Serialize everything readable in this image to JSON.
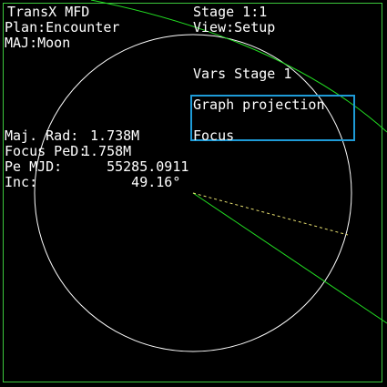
{
  "mfd": {
    "title": "TransX MFD",
    "plan": "Plan:Encounter",
    "maj": "MAJ:Moon",
    "stage": "Stage 1:1",
    "view": "View:Setup",
    "vars_header": "Vars Stage 1",
    "options": [
      {
        "label": "Graph projection",
        "selected": true
      },
      {
        "label": "Focus",
        "selected": true
      }
    ]
  },
  "readouts": [
    {
      "label": "Maj. Rad:",
      "value": " 1.738M"
    },
    {
      "label": "Focus PeD:",
      "value": "1.758M"
    },
    {
      "label": "Pe MJD:",
      "value": "   55285.0911"
    },
    {
      "label": "Inc:",
      "value": "      49.16°"
    }
  ],
  "colors": {
    "background": "#000000",
    "frame": "#3cc83c",
    "text": "#ffffff",
    "orbit_circle": "#ffffff",
    "trajectory": "#22dd22",
    "periapsis_marker": "#e8e070",
    "selection": "#1e9bd7"
  }
}
